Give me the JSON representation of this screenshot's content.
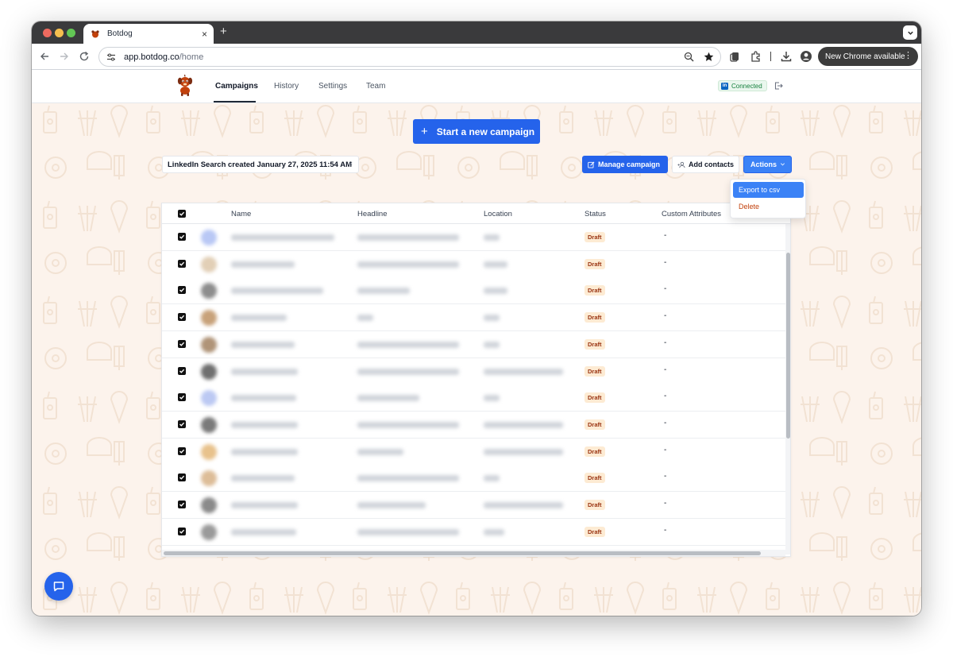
{
  "browser": {
    "tab_title": "Botdog",
    "tab_close": "×",
    "new_tab": "+",
    "url_host": "app.botdog.co",
    "url_path": "/home",
    "update_pill": "New Chrome available",
    "update_menu": "⋮"
  },
  "header": {
    "nav": [
      {
        "label": "Campaigns",
        "active": true
      },
      {
        "label": "History",
        "active": false
      },
      {
        "label": "Settings",
        "active": false
      },
      {
        "label": "Team",
        "active": false
      }
    ],
    "linkedin_glyph": "in",
    "connected_label": "Connected"
  },
  "campaign": {
    "start_button": "Start a new campaign",
    "start_plus": "+",
    "filter_chip": "LinkedIn Search created January 27, 2025 11:54 AM",
    "filter_chip_close": "×",
    "manage_button": "Manage campaign",
    "add_contacts_button": "Add contacts",
    "actions_button": "Actions"
  },
  "actions_menu": {
    "export": "Export to csv",
    "delete": "Delete"
  },
  "table": {
    "columns": {
      "name": "Name",
      "headline": "Headline",
      "location": "Location",
      "status": "Status",
      "custom": "Custom Attributes"
    },
    "rows": [
      {
        "status": "Draft",
        "custom": "-",
        "avatar_color": "#b9c8f5"
      },
      {
        "status": "Draft",
        "custom": "-",
        "avatar_color": "#e2cfb6"
      },
      {
        "status": "Draft",
        "custom": "-",
        "avatar_color": "#8d8d8d"
      },
      {
        "status": "Draft",
        "custom": "-",
        "avatar_color": "#c8a27a"
      },
      {
        "status": "Draft",
        "custom": "-",
        "avatar_color": "#b09478"
      },
      {
        "status": "Draft",
        "custom": "-",
        "avatar_color": "#6f6f6f"
      },
      {
        "status": "Draft",
        "custom": "-",
        "avatar_color": "#bcc9f3"
      },
      {
        "status": "Draft",
        "custom": "-",
        "avatar_color": "#7a7a7a"
      },
      {
        "status": "Draft",
        "custom": "-",
        "avatar_color": "#e8c28c"
      },
      {
        "status": "Draft",
        "custom": "-",
        "avatar_color": "#ddbd98"
      },
      {
        "status": "Draft",
        "custom": "-",
        "avatar_color": "#8a8a8a"
      },
      {
        "status": "Draft",
        "custom": "-",
        "avatar_color": "#9a9a9a"
      }
    ]
  },
  "colors": {
    "primary": "#2563eb",
    "draft_bg": "#fdebd3",
    "draft_text": "#9a3412",
    "delete_text": "#c2410c",
    "content_bg": "#fcf3ec"
  },
  "icons": [
    "back-icon",
    "forward-icon",
    "reload-icon",
    "site-info-icon",
    "zoom-icon",
    "bookmark-star-icon",
    "tab-search-icon",
    "extensions-icon",
    "downloads-icon",
    "profile-icon",
    "linkedin-icon",
    "logout-icon",
    "edit-icon",
    "add-user-icon",
    "chevron-down-icon",
    "checkbox-checked-icon",
    "chat-icon"
  ]
}
